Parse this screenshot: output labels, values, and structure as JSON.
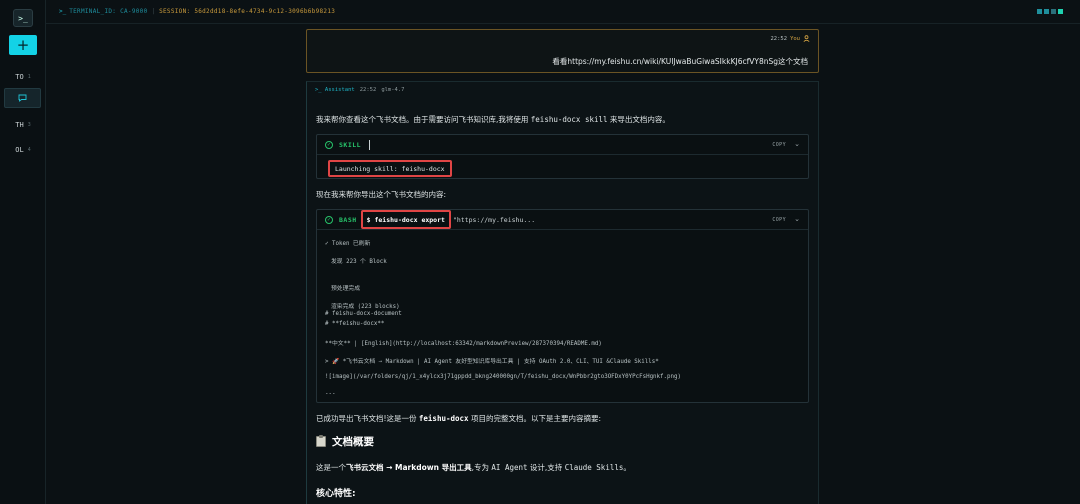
{
  "rail": {
    "logo_glyph": ">_",
    "add_glyph": "+",
    "items": [
      {
        "label": "TO",
        "num": "1"
      },
      {
        "label": "TH",
        "num": "3"
      },
      {
        "label": "OL",
        "num": "4"
      }
    ]
  },
  "topbar": {
    "prompt": ">_",
    "terminal_id": "TERMINAL_ID: CA-9000",
    "separator": "|",
    "session": "SESSION: 56d2dd18-8efe-4734-9c12-3096b6b98213",
    "dot_colors": [
      "#1f8f9c",
      "#1f8f9c",
      "#2a6f7a",
      "#1fd2b0"
    ]
  },
  "user_message": {
    "time": "22:52",
    "author": "You",
    "text": "看看https://my.feishu.cn/wiki/KUIJwaBuGiwaSIkkKJ6cfVY8nSg这个文档"
  },
  "assistant": {
    "name": ">_ Assistant",
    "time": "22:52",
    "model": "glm-4.7",
    "intro_pre": "我来帮你查看这个飞书文档。由于需要访问飞书知识库,我将使用 ",
    "intro_code": "feishu-docx skill",
    "intro_post": " 来导出文档内容。",
    "skill_tool": {
      "label": "SKILL",
      "copy": "COPY",
      "output": "Launching skill: feishu-docx"
    },
    "mid_text": "现在我来帮你导出这个飞书文档的内容:",
    "bash_tool": {
      "label": "BASH",
      "copy": "COPY",
      "command": "$ feishu-docx export",
      "command_arg": "\"https://my.feishu...",
      "output_lines": [
        "✓ Token 已刷新",
        "  发现 223 个 Block",
        "  预处理完成",
        "  渲染完成 (223 blocks)",
        "# feishu-docx-document",
        "# **feishu-docx**",
        "**中文** | [English](http://localhost:63342/markdownPreview/287370394/README.md)",
        "> 🚀 *飞书云文档 → Markdown | AI Agent 友好型知识库导出工具 | 支持 OAuth 2.0、CLI、TUI &Claude Skills*",
        "![image](/var/folders/qj/1_x4ylcx3j71gppdd_bkng240000gn/T/feishu_docx/WnPbbr2gto3OFDxY0YPcFsHgnkf.png)",
        "---"
      ]
    },
    "done_pre": "已成功导出飞书文档!这是一份 ",
    "done_code": "feishu-docx",
    "done_post": " 项目的完整文档。以下是主要内容摘要:",
    "section_title": "文档概要",
    "overview_pre": "这是一个",
    "overview_b1": "飞书云文档 → Markdown 导出工具",
    "overview_mid": ",专为 ",
    "overview_code1": "AI Agent",
    "overview_mid2": " 设计,支持 ",
    "overview_code2": "Claude Skills",
    "overview_post": "。",
    "features_title": "核心特性:"
  }
}
